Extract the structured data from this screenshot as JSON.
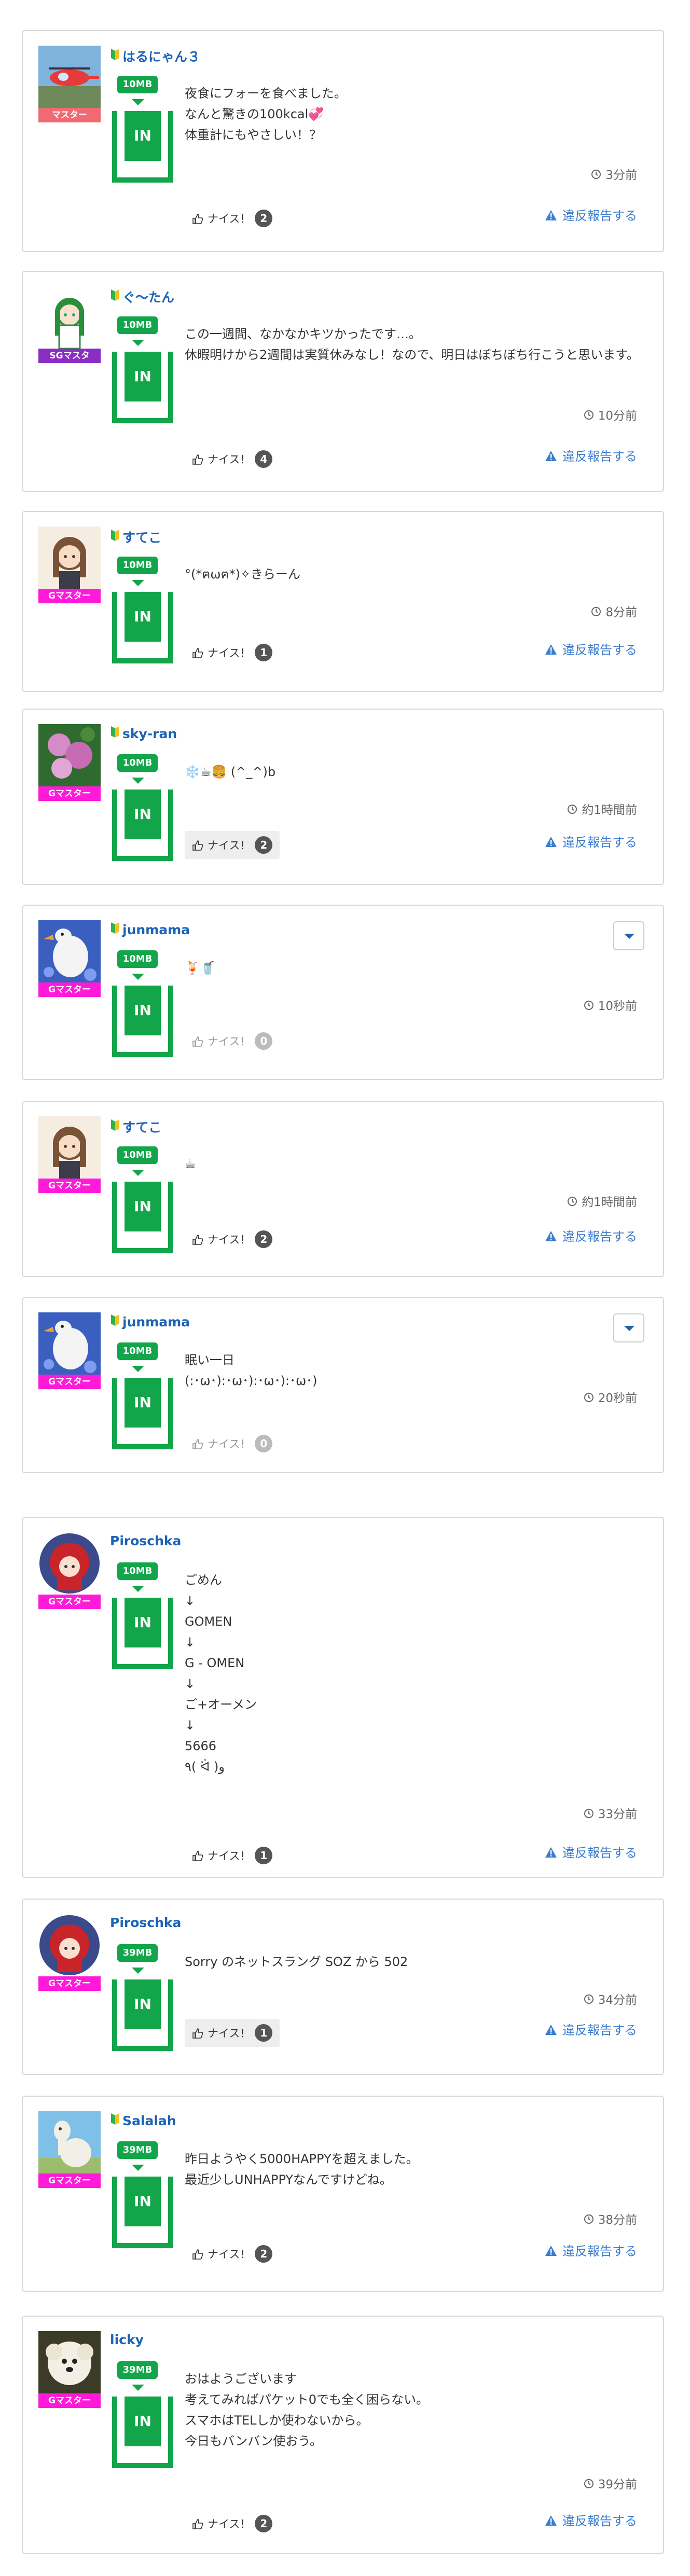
{
  "ui": {
    "nice_label": "ナイス！",
    "report_label": "違反報告する"
  },
  "colors": {
    "green": "#12a54a",
    "link_blue": "#1b63b7",
    "report_blue": "#3b7dcf",
    "rank_master": "#f06a73",
    "rank_sg": "#8a2dc2",
    "rank_g": "#ff1ad9"
  },
  "posts": [
    {
      "user": "はるにゃん３",
      "beginner": true,
      "rank": "マスター",
      "mb": "10MB",
      "in": "IN",
      "text": "夜食にフォーを食べました。\nなんと驚きの100kcal💞\n体重計にもやさしい！？",
      "time": "3分前",
      "nice": "2",
      "avatar_icon": "helicopter-photo-icon"
    },
    {
      "user": "ぐ〜たん",
      "beginner": true,
      "rank": "SGマスタ",
      "mb": "10MB",
      "in": "IN",
      "text": "この一週間、なかなかキツかったです…。\n休暇明けから2週間は実質休みなし！なので、明日はぼちぼち行こうと思います。",
      "time": "10分前",
      "nice": "4",
      "avatar_icon": "anime-girl-icon"
    },
    {
      "user": "すてこ",
      "beginner": true,
      "rank": "Gマスター",
      "mb": "10MB",
      "in": "IN",
      "text": "°(*ฅωฅ*)✧きらーん",
      "time": "8分前",
      "nice": "1",
      "avatar_icon": "anime-girl-brown-icon"
    },
    {
      "user": "sky-ran",
      "beginner": true,
      "rank": "Gマスター",
      "mb": "10MB",
      "in": "IN",
      "text": "❄️☕🍔 (^_^)b",
      "time": "約1時間前",
      "nice": "2",
      "avatar_icon": "hydrangea-photo-icon"
    },
    {
      "user": "junmama",
      "beginner": true,
      "rank": "Gマスター",
      "mb": "10MB",
      "in": "IN",
      "text": "🍹🥤",
      "time": "10秒前",
      "nice": "0",
      "avatar_icon": "swan-photo-icon"
    },
    {
      "user": "すてこ",
      "beginner": true,
      "rank": "Gマスター",
      "mb": "10MB",
      "in": "IN",
      "text": "☕",
      "time": "約1時間前",
      "nice": "2",
      "avatar_icon": "anime-girl-brown-icon"
    },
    {
      "user": "junmama",
      "beginner": true,
      "rank": "Gマスター",
      "mb": "10MB",
      "in": "IN",
      "text": "眠い一日\n(:･ω･):･ω･):･ω･):･ω･)",
      "time": "20秒前",
      "nice": "0",
      "avatar_icon": "swan-photo-icon"
    },
    {
      "user": "Piroschka",
      "beginner": false,
      "rank": "Gマスター",
      "mb": "10MB",
      "in": "IN",
      "text": "ごめん\n↓\nGOMEN\n↓\nG - OMEN\n↓\nご+オーメン\n↓\n5666\n٩( ᐛ )و",
      "time": "33分前",
      "nice": "1",
      "avatar_icon": "red-hood-girl-icon"
    },
    {
      "user": "Piroschka",
      "beginner": false,
      "rank": "Gマスター",
      "mb": "39MB",
      "in": "IN",
      "text": "Sorry のネットスラング SOZ から 502",
      "time": "34分前",
      "nice": "1",
      "avatar_icon": "red-hood-girl-icon"
    },
    {
      "user": "Salalah",
      "beginner": true,
      "rank": "Gマスター",
      "mb": "39MB",
      "in": "IN",
      "text": "昨日ようやく5000HAPPYを超えました。\n最近少しUNHAPPYなんですけどね。",
      "time": "38分前",
      "nice": "2",
      "avatar_icon": "alpaca-photo-icon"
    },
    {
      "user": "licky",
      "beginner": false,
      "rank": "Gマスター",
      "mb": "39MB",
      "in": "IN",
      "text": "おはようございます\n考えてみればパケット0でも全く困らない。\nスマホはTELしか使わないから。\n今日もバンバン使おう。",
      "time": "39分前",
      "nice": "2",
      "avatar_icon": "dog-photo-icon"
    }
  ]
}
